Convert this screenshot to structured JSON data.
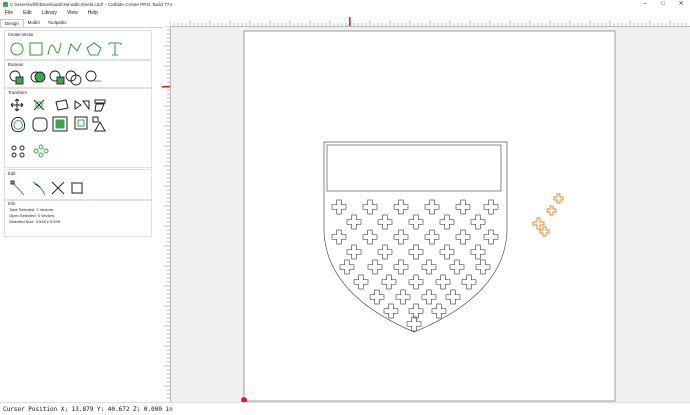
{
  "window": {
    "title": "C:\\Users\\willfr\\Downloads\\HeraldicShield.c2d* - Carbide Create PRO, Build 774",
    "controls": [
      "minimize-icon",
      "maximize-icon",
      "close-icon"
    ]
  },
  "menu": [
    "File",
    "Edit",
    "Library",
    "View",
    "Help"
  ],
  "tabs": [
    "Design",
    "Model",
    "Toolpaths"
  ],
  "panel": {
    "create_vector": {
      "header": "Create Vector",
      "icons": [
        "circle-icon",
        "rectangle-icon",
        "curve-icon",
        "polyline-icon",
        "polygon-icon",
        "text-icon"
      ]
    },
    "boolean": {
      "header": "Boolean",
      "icons": [
        "join-icon",
        "weld-icon",
        "subtract-icon",
        "intersect-icon",
        "trim-icon"
      ]
    },
    "transform": {
      "header": "Transform",
      "icons": [
        "move-icon",
        "scale-icon",
        "rotate-icon",
        "mirror-icon",
        "align-icon",
        "offset-icon",
        "fillet-icon",
        "boundary-icon",
        "inset-icon",
        "node-edit-icon",
        "array-icon",
        "radial-array-icon"
      ]
    },
    "edit": {
      "header": "Edit",
      "icons": [
        "node-edit-icon",
        "knife-icon",
        "cut-icon",
        "select-box-icon"
      ]
    },
    "info": {
      "header": "Info",
      "total_selected": "Total Selected:  2 Vectors",
      "open_selected": "Open Selected:  0 Vectors",
      "selected_size": "Selected Size:   3.528 x 5.999"
    }
  },
  "status": {
    "cursor": "Cursor Position X: 13.879 Y: 40.672 Z: 0.000 in"
  },
  "colors": {
    "vector": "#555555",
    "selected": "#e8821e",
    "ruler_marker": "#e02020",
    "icon_green": "#3fa34d"
  }
}
